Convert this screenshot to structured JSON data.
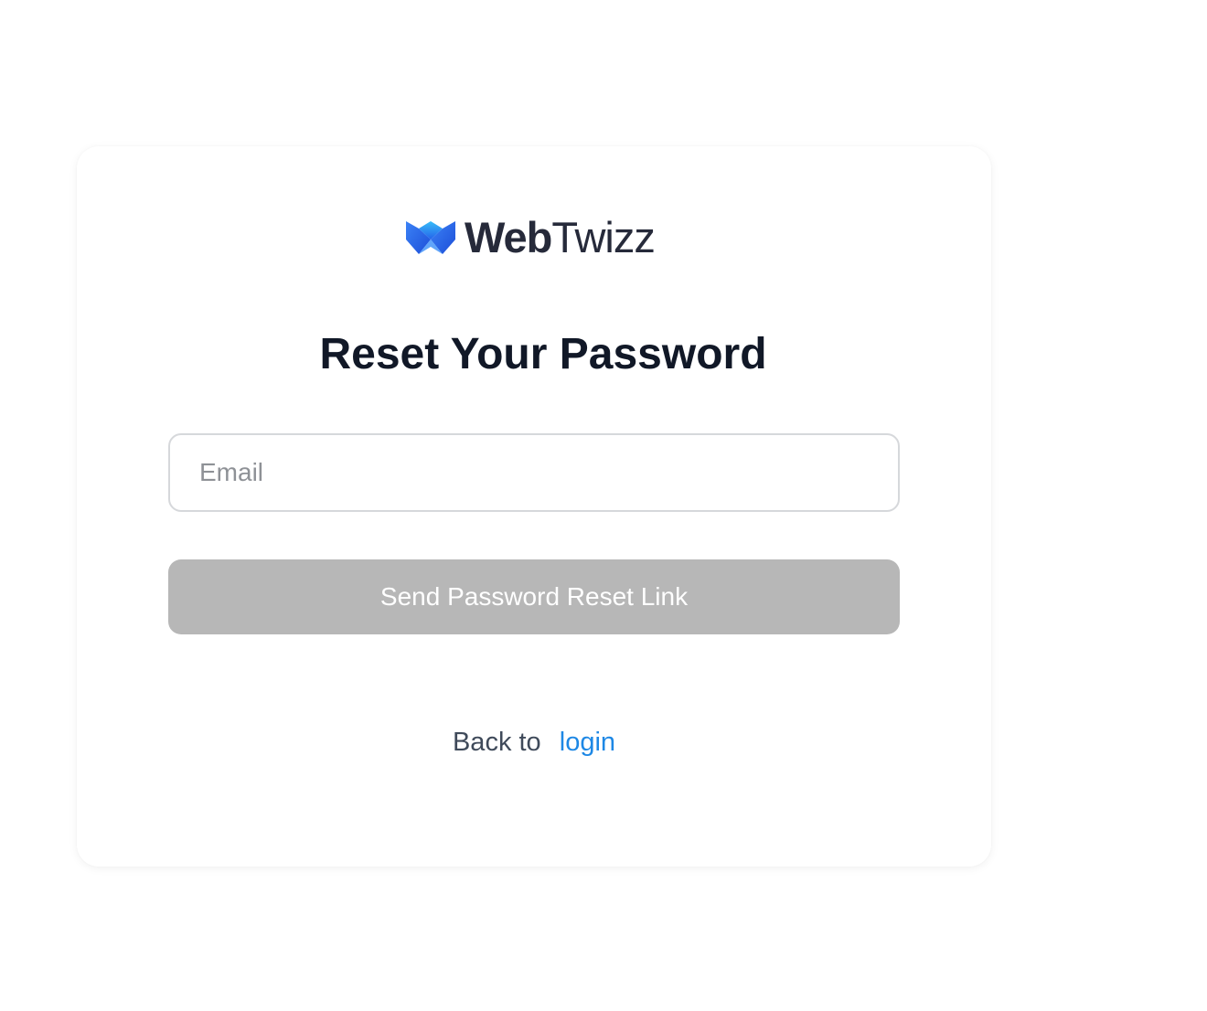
{
  "brand": {
    "name_bold": "Web",
    "name_light": "Twizz",
    "logo_icon": "webtwizz-w-logo-icon",
    "colors": {
      "logo_dark_blue": "#1d4ed8",
      "logo_light_blue": "#38bdf8",
      "text": "#262a3a"
    }
  },
  "form": {
    "title": "Reset Your Password",
    "email_placeholder": "Email",
    "email_value": "",
    "submit_label": "Send Password Reset Link",
    "submit_state": "disabled"
  },
  "footer": {
    "back_text": "Back to",
    "login_link": "login"
  },
  "colors": {
    "title": "#111827",
    "button_disabled_bg": "#b7b7b7",
    "link": "#1e88e5",
    "input_border": "#d6d8db"
  }
}
